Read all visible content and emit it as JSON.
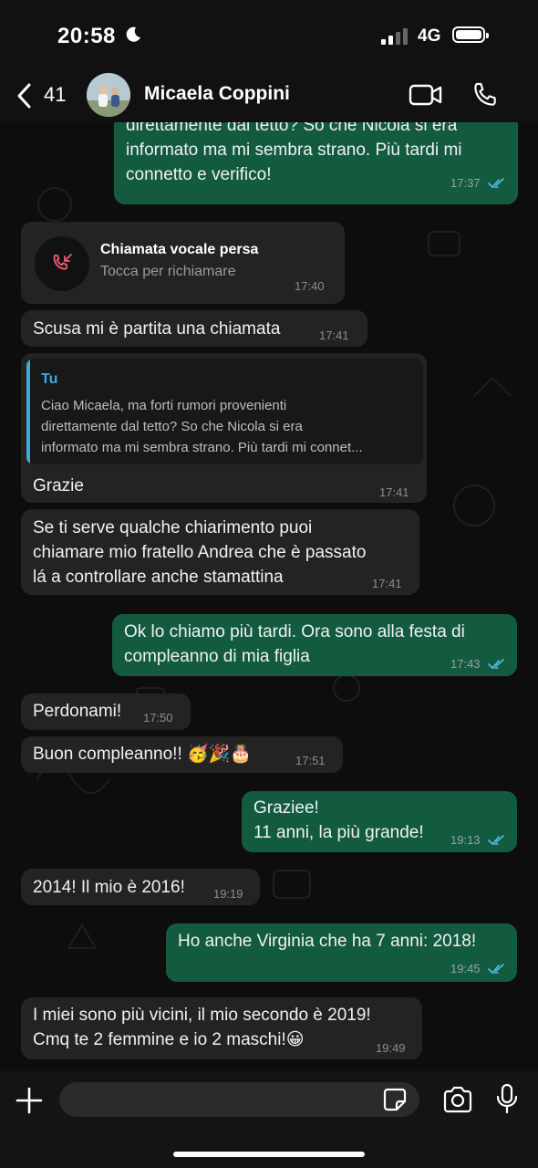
{
  "status_bar": {
    "time": "20:58",
    "network": "4G"
  },
  "header": {
    "back_count": "41",
    "contact_name": "Micaela Coppini"
  },
  "messages": [
    {
      "dir": "out",
      "text": "direttamente dal tetto? So che Nicola si era\ninformato ma mi sembra strano. Più tardi mi\nconnetto e verifico!",
      "time": "17:37"
    },
    {
      "dir": "in",
      "type": "call",
      "title": "Chiamata vocale persa",
      "subtitle": "Tocca per richiamare",
      "time": "17:40"
    },
    {
      "dir": "in",
      "text": "Scusa mi è partita una chiamata",
      "time": "17:41"
    },
    {
      "dir": "in",
      "type": "reply",
      "quote_author": "Tu",
      "quote_text": "Ciao Micaela, ma forti rumori provenienti\ndirettamente dal tetto? So che Nicola si era\ninformato ma mi sembra strano. Più tardi mi connet...",
      "text": "Grazie",
      "time": "17:41"
    },
    {
      "dir": "in",
      "text": "Se ti serve qualche chiarimento puoi\nchiamare mio fratello Andrea che è passato\nlá a controllare anche stamattina",
      "time": "17:41"
    },
    {
      "dir": "out",
      "text": "Ok lo chiamo più tardi. Ora sono alla festa di\ncompleanno di mia figlia",
      "time": "17:43"
    },
    {
      "dir": "in",
      "text": "Perdonami!",
      "time": "17:50"
    },
    {
      "dir": "in",
      "text": "Buon compleanno!! 🥳🎉🎂",
      "time": "17:51"
    },
    {
      "dir": "out",
      "text": "Graziee!\n11 anni, la più grande!",
      "time": "19:13"
    },
    {
      "dir": "in",
      "text": "2014! Il mio è 2016!",
      "time": "19:19"
    },
    {
      "dir": "out",
      "text": "Ho anche Virginia che ha 7 anni: 2018!",
      "time": "19:45"
    },
    {
      "dir": "in",
      "text": "I miei sono più vicini, il mio secondo è 2019!\nCmq te 2 femmine e io 2 maschi!😀",
      "time": "19:49"
    }
  ],
  "colors": {
    "outgoing": "#135b3f",
    "incoming": "#232323",
    "read_ticks": "#53bdeb",
    "missed_call": "#f15c6d"
  }
}
